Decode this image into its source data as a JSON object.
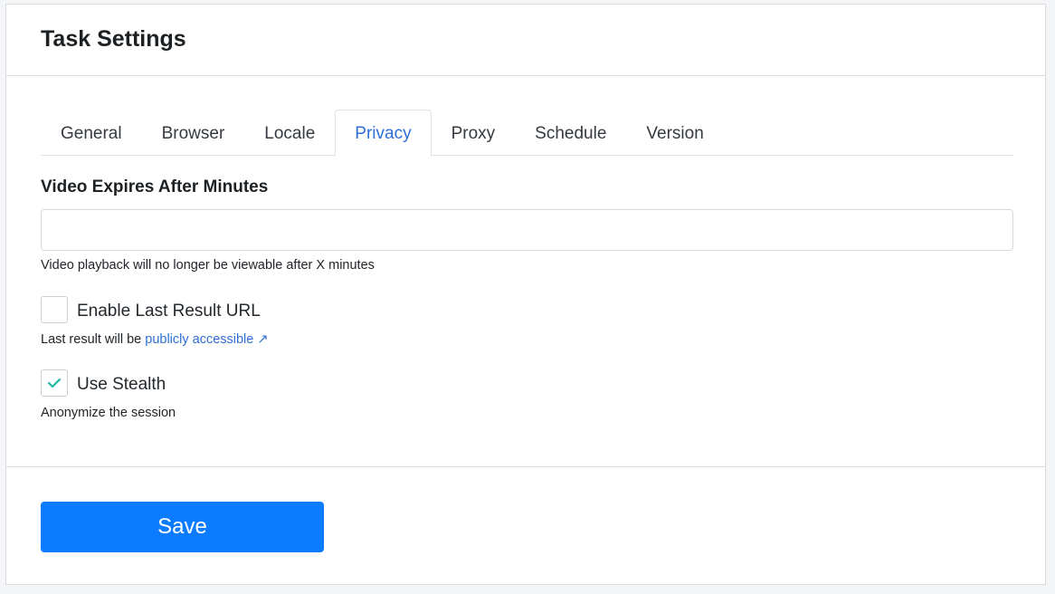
{
  "header": {
    "title": "Task Settings"
  },
  "tabs": [
    {
      "label": "General",
      "active": false
    },
    {
      "label": "Browser",
      "active": false
    },
    {
      "label": "Locale",
      "active": false
    },
    {
      "label": "Privacy",
      "active": true
    },
    {
      "label": "Proxy",
      "active": false
    },
    {
      "label": "Schedule",
      "active": false
    },
    {
      "label": "Version",
      "active": false
    }
  ],
  "video_expires": {
    "label": "Video Expires After Minutes",
    "value": "",
    "help": "Video playback will no longer be viewable after X minutes"
  },
  "last_result_url": {
    "label": "Enable Last Result URL",
    "checked": false,
    "help_prefix": "Last result will be ",
    "help_link": "publicly accessible ↗"
  },
  "use_stealth": {
    "label": "Use Stealth",
    "checked": true,
    "help": "Anonymize the session"
  },
  "footer": {
    "save_label": "Save"
  },
  "colors": {
    "accent": "#0b7bff",
    "link": "#2f6fd6",
    "check": "#1fb6a2"
  },
  "icons": {
    "check": "check-icon",
    "external_link": "external-link-icon"
  }
}
